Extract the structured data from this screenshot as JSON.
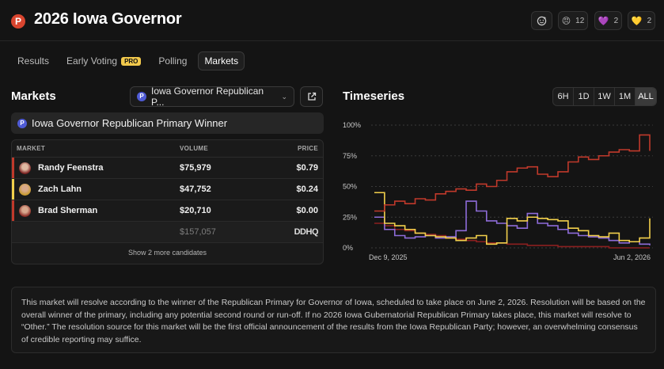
{
  "app": {
    "logo_letter": "P",
    "title": "2026 Iowa Governor"
  },
  "header_actions": [
    {
      "icon": "smiley-icon",
      "count": ""
    },
    {
      "icon": "😠",
      "count": "12"
    },
    {
      "icon": "💜",
      "count": "2"
    },
    {
      "icon": "💛",
      "count": "2"
    }
  ],
  "tabs": [
    {
      "label": "Results",
      "active": false
    },
    {
      "label": "Early Voting",
      "badge": "PRO",
      "active": false
    },
    {
      "label": "Polling",
      "active": false
    },
    {
      "label": "Markets",
      "active": true
    }
  ],
  "markets": {
    "title": "Markets",
    "select_value": "Iowa Governor Republican P...",
    "market_name": "Iowa Governor Republican Primary Winner",
    "columns": {
      "market": "MARKET",
      "volume": "VOLUME",
      "price": "PRICE"
    },
    "rows": [
      {
        "name": "Randy Feenstra",
        "volume": "$75,979",
        "price": "$0.79",
        "color": "#c0392b"
      },
      {
        "name": "Zach Lahn",
        "volume": "$47,752",
        "price": "$0.24",
        "color": "#f2d04b"
      },
      {
        "name": "Brad Sherman",
        "volume": "$20,710",
        "price": "$0.00",
        "color": "#c0392b"
      }
    ],
    "total_volume": "$157,057",
    "source_logo": "DDHQ",
    "show_more": "Show 2 more candidates"
  },
  "timeseries": {
    "title": "Timeseries",
    "ranges": [
      "6H",
      "1D",
      "1W",
      "1M",
      "ALL"
    ],
    "active_range": "ALL"
  },
  "chart_data": {
    "type": "line",
    "y_ticks": [
      "100%",
      "75%",
      "50%",
      "25%",
      "0%"
    ],
    "ylim": [
      0,
      100
    ],
    "x_ticks": [
      "Dec 9, 2025",
      "Jun 2, 2026"
    ],
    "series": [
      {
        "color": "#c0392b",
        "values": [
          30,
          35,
          38,
          36,
          40,
          39,
          44,
          46,
          48,
          47,
          52,
          50,
          55,
          62,
          65,
          66,
          60,
          58,
          62,
          70,
          74,
          72,
          75,
          78,
          80,
          79,
          92,
          79
        ]
      },
      {
        "color": "#f2d04b",
        "values": [
          45,
          20,
          18,
          15,
          12,
          10,
          9,
          8,
          6,
          8,
          10,
          3,
          4,
          24,
          22,
          25,
          24,
          23,
          22,
          16,
          14,
          10,
          9,
          12,
          6,
          5,
          8,
          24
        ]
      },
      {
        "color": "#8e6cd9",
        "values": [
          25,
          15,
          10,
          8,
          9,
          10,
          8,
          9,
          14,
          38,
          30,
          22,
          20,
          18,
          16,
          28,
          20,
          18,
          15,
          12,
          10,
          9,
          8,
          6,
          4,
          5,
          3,
          2
        ]
      },
      {
        "color": "#8b1f1f",
        "values": [
          20,
          18,
          15,
          14,
          12,
          11,
          10,
          8,
          7,
          6,
          5,
          4,
          4,
          3,
          3,
          2,
          2,
          2,
          1,
          1,
          1,
          1,
          1,
          0,
          0,
          0,
          0,
          0
        ]
      }
    ]
  },
  "description": "This market will resolve according to the winner of the Republican Primary for Governor of Iowa, scheduled to take place on June 2, 2026. Resolution will be based on the overall winner of the primary, including any potential second round or run-off. If no 2026 Iowa Gubernatorial Republican Primary takes place, this market will resolve to “Other.” The resolution source for this market will be the first official announcement of the results from the Iowa Republican Party; however, an overwhelming consensus of credible reporting may suffice."
}
